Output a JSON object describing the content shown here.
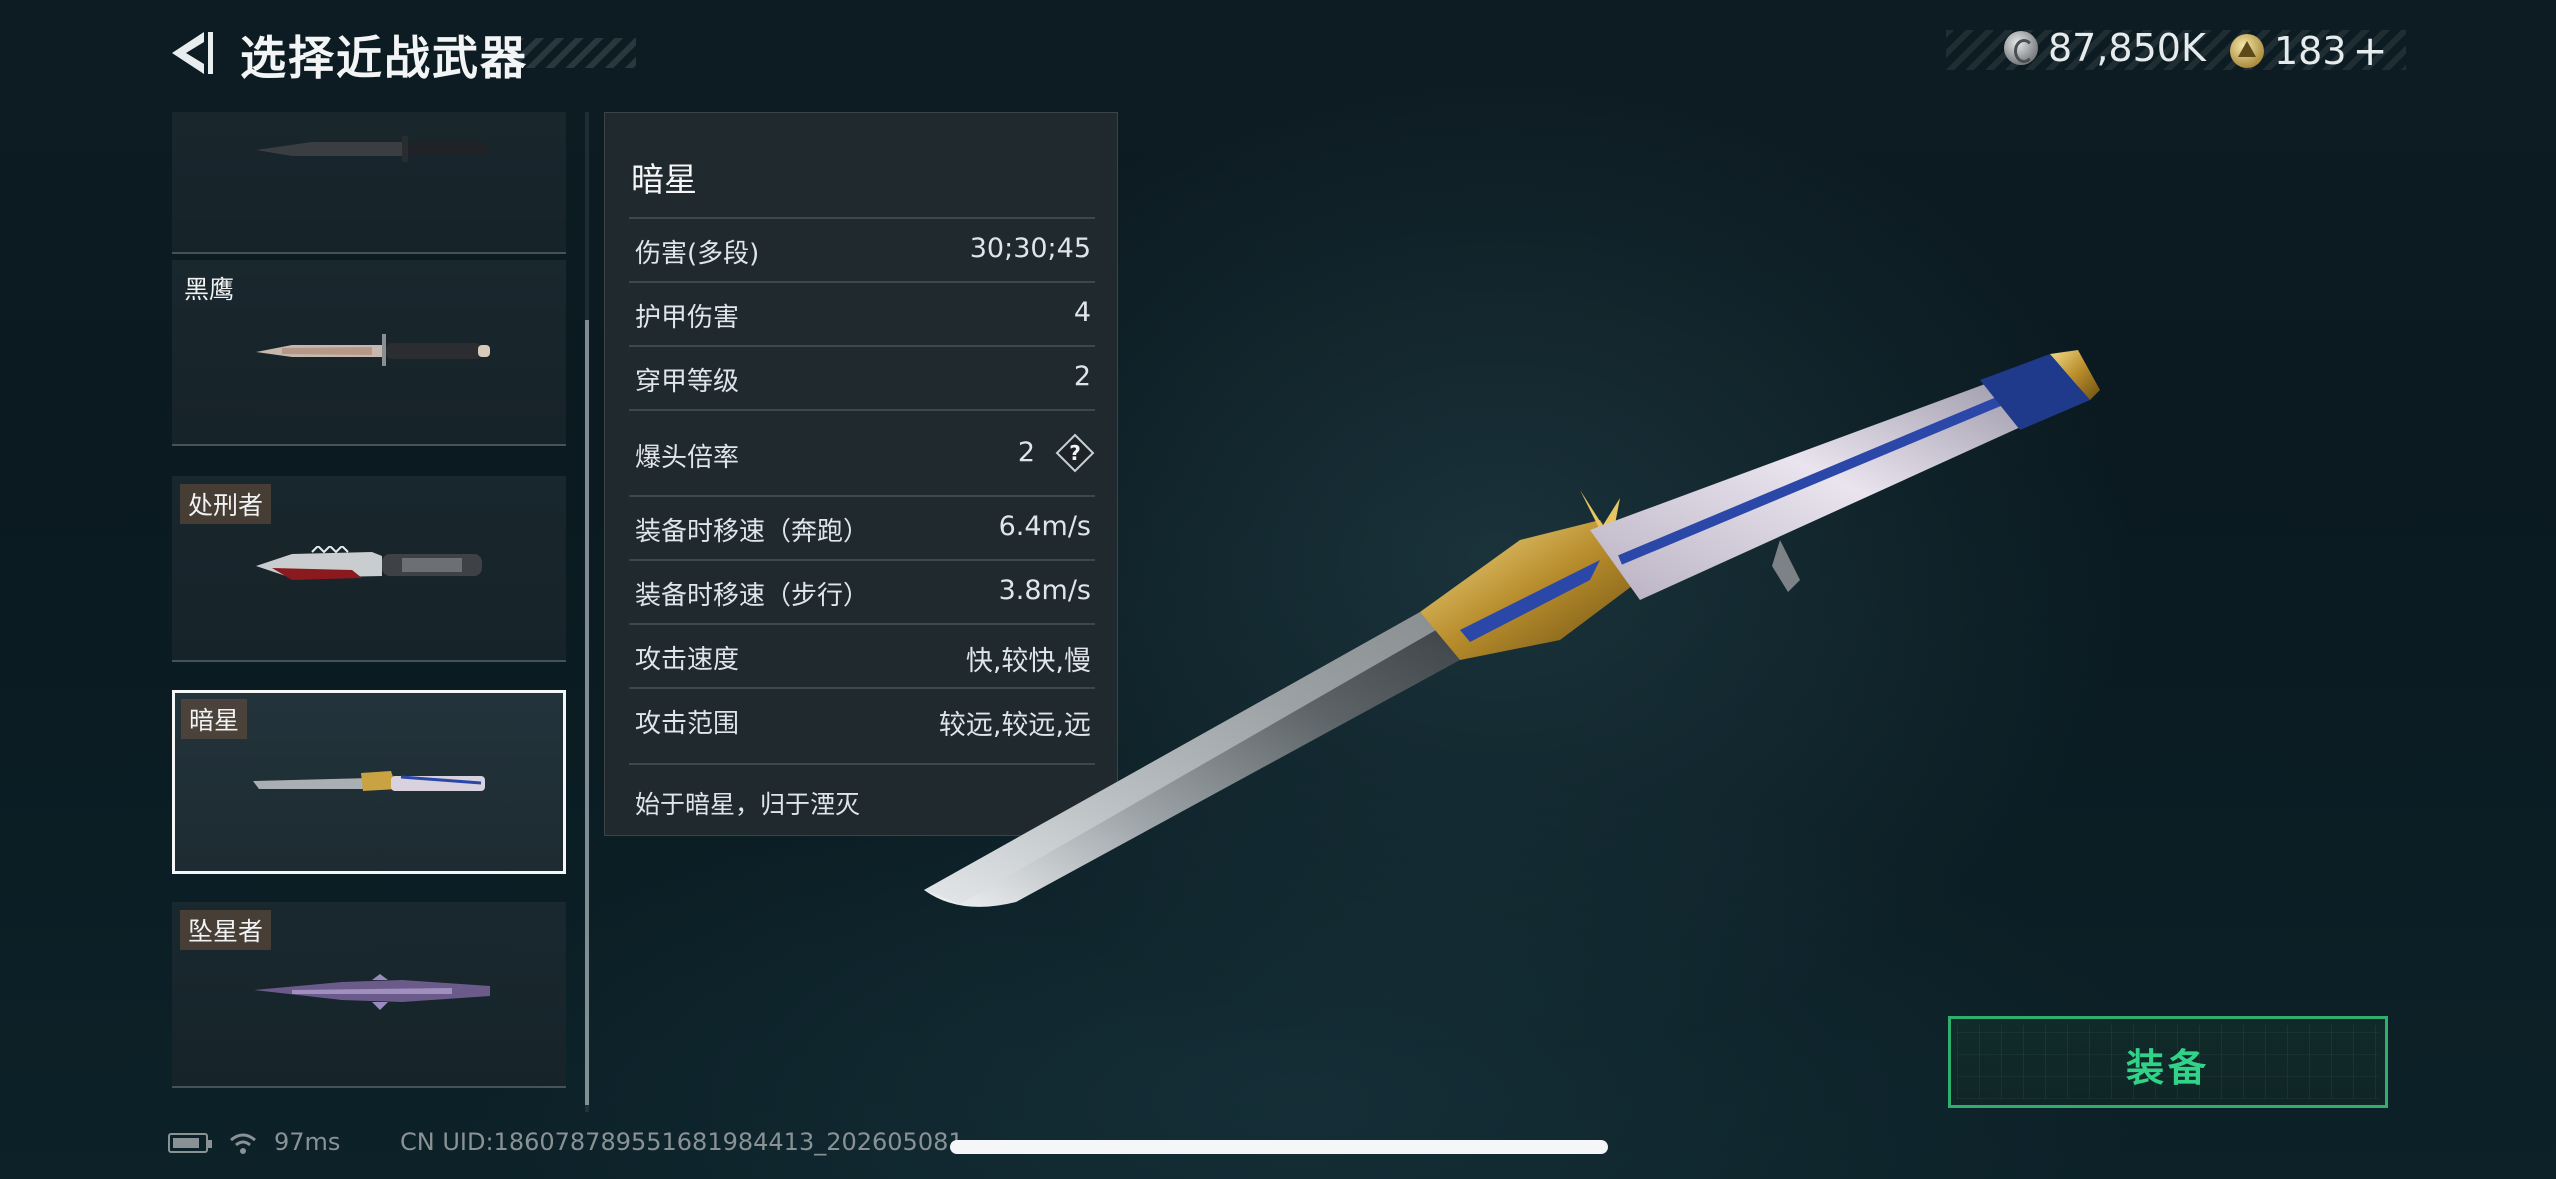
{
  "header": {
    "title": "选择近战武器"
  },
  "currency": {
    "silver_amount": "87,850K",
    "gold_amount": "183",
    "plus_symbol": "+"
  },
  "weapon_list": {
    "items": [
      {
        "label": ""
      },
      {
        "label": "黑鹰"
      },
      {
        "label": "处刑者"
      },
      {
        "label": "暗星",
        "selected": true
      },
      {
        "label": "坠星者"
      }
    ]
  },
  "stats": {
    "name": "暗星",
    "rows": [
      {
        "label": "伤害(多段)",
        "value": "30;30;45"
      },
      {
        "label": "护甲伤害",
        "value": "4"
      },
      {
        "label": "穿甲等级",
        "value": "2"
      },
      {
        "label": "爆头倍率",
        "value": "2",
        "help": "?"
      },
      {
        "label": "装备时移速（奔跑）",
        "value": "6.4m/s"
      },
      {
        "label": "装备时移速（步行）",
        "value": "3.8m/s"
      },
      {
        "label": "攻击速度",
        "value": "快,较快,慢"
      },
      {
        "label": "攻击范围",
        "value": "较远,较远,远"
      }
    ],
    "description": "始于暗星，归于湮灭"
  },
  "equip": {
    "label": "装备"
  },
  "status_bar": {
    "ping": "97ms",
    "uid": "CN UID:1860787895516819844​13_202605081"
  },
  "icons": {
    "back": "back-arrow-icon",
    "silver_coin": "silver-coin-icon",
    "gold_coin": "gold-coin-icon",
    "battery": "battery-icon",
    "wifi": "wifi-icon"
  },
  "colors": {
    "equip_accent": "#31d389",
    "equip_border": "#2fae6e",
    "selected_border": "#f4f6f7",
    "background": "#0d1c22"
  }
}
